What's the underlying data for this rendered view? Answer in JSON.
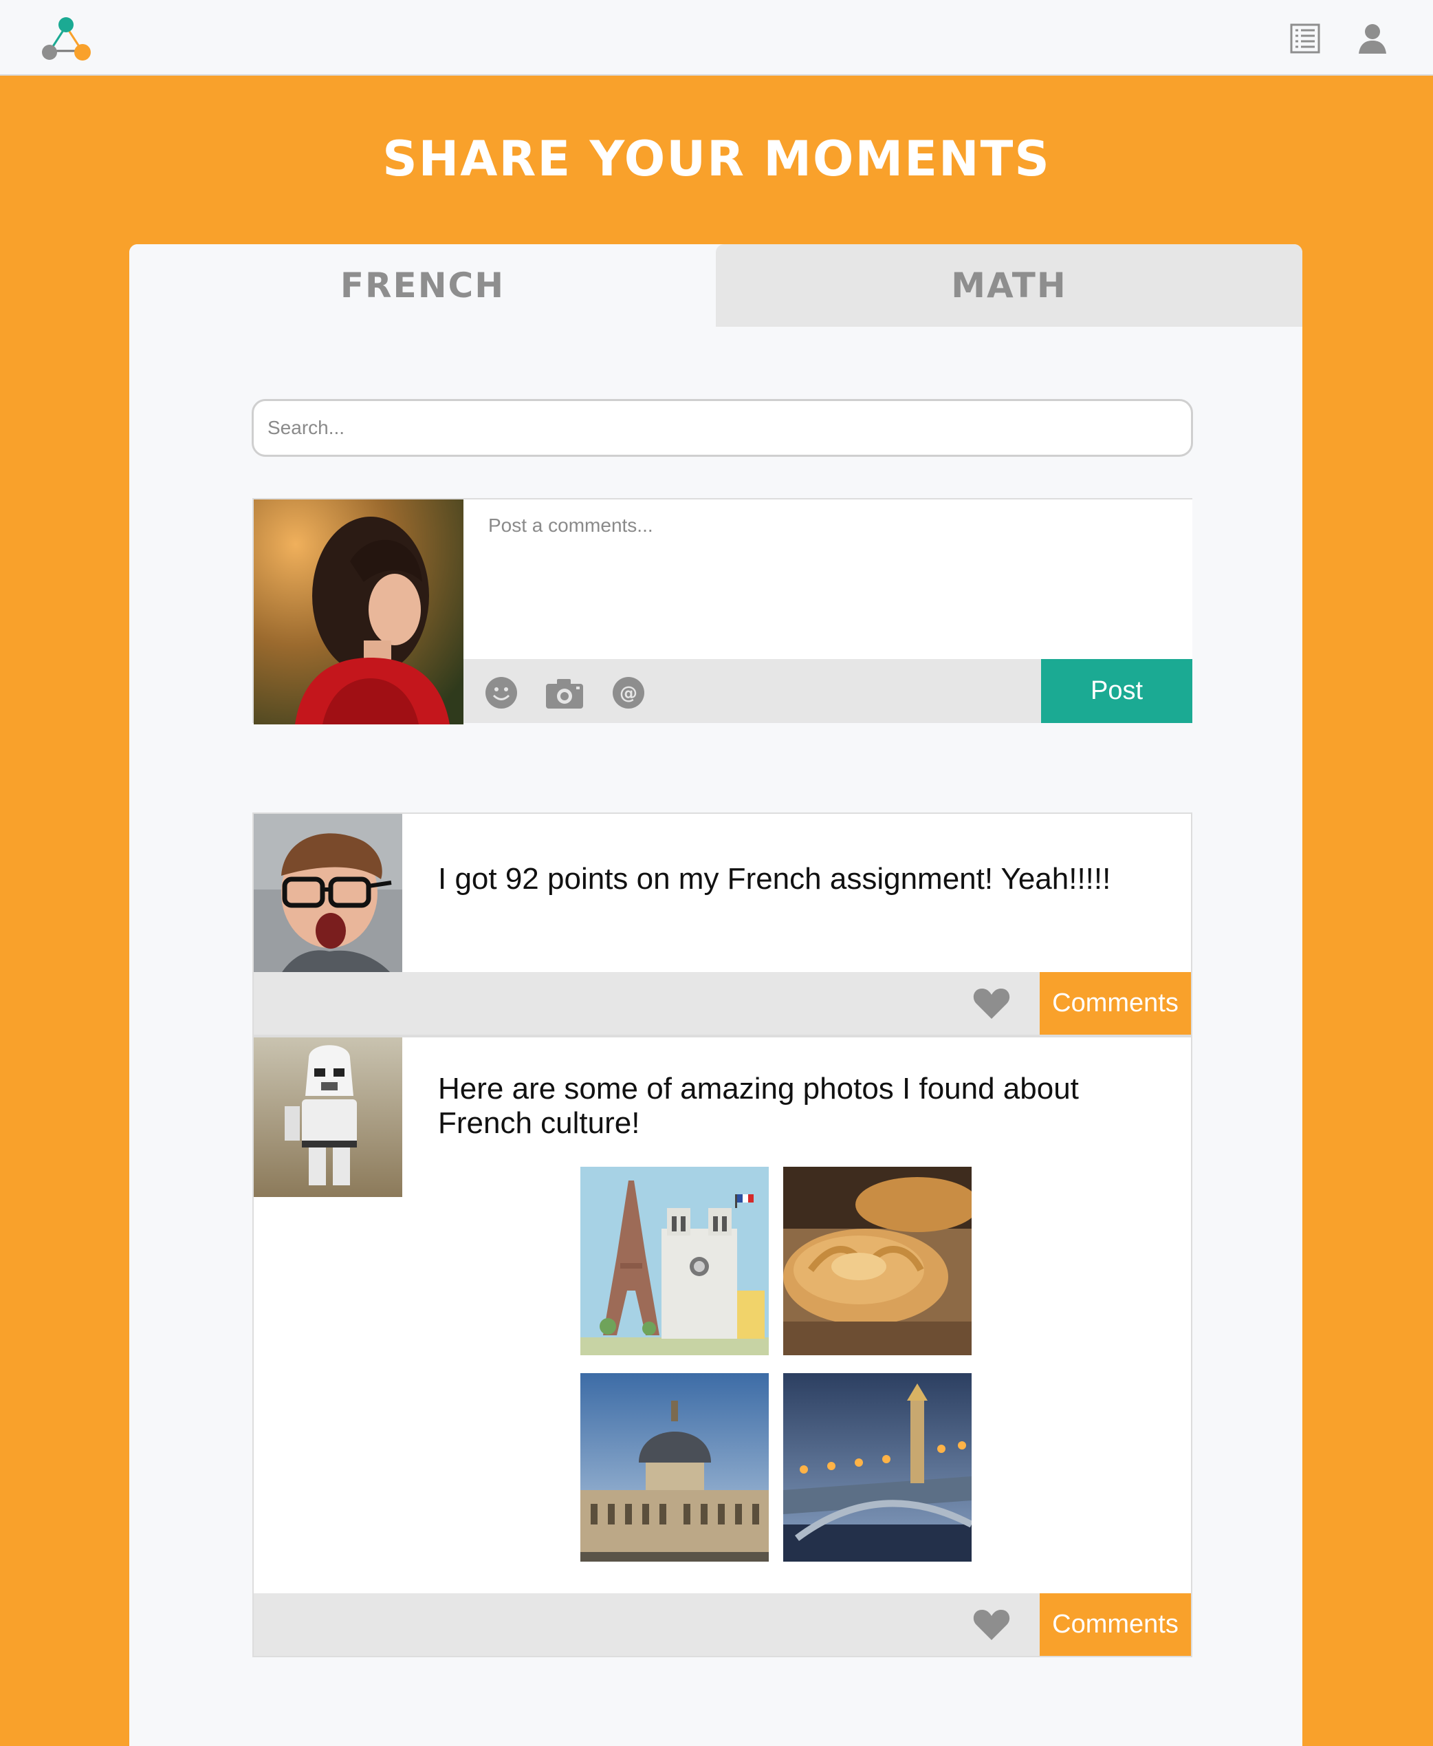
{
  "header": {
    "logo_icon": "triangle-nodes-logo",
    "right_icons": [
      "list-icon",
      "user-icon"
    ]
  },
  "page": {
    "title": "SHARE YOUR MOMENTS"
  },
  "tabs": [
    {
      "label": "FRENCH",
      "active": true
    },
    {
      "label": "MATH",
      "active": false
    }
  ],
  "search": {
    "placeholder": "Search..."
  },
  "composer": {
    "placeholder": "Post a comments...",
    "tools": [
      "smiley-icon",
      "camera-icon",
      "at-icon"
    ],
    "post_label": "Post"
  },
  "posts": [
    {
      "text": "I got 92 points on my French assignment! Yeah!!!!!",
      "comments_label": "Comments"
    },
    {
      "text": "Here are some of amazing photos I found about French culture!",
      "comments_label": "Comments",
      "photos": [
        "eiffel-notre-dame-illustration",
        "croissants-photo",
        "institut-de-france-photo",
        "pont-alexandre-iii-photo"
      ]
    }
  ],
  "colors": {
    "brand_orange": "#F9A12B",
    "teal": "#1BAA93",
    "panel": "#F7F8FA",
    "bar_gray": "#E6E6E6"
  }
}
